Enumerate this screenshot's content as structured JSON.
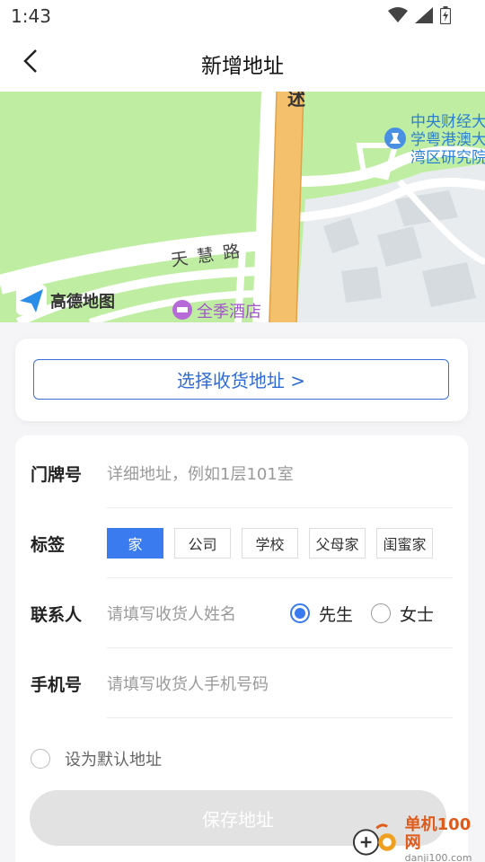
{
  "status": {
    "time": "1:43"
  },
  "nav": {
    "title": "新增地址"
  },
  "map": {
    "labels": {
      "road": "天 慧 路",
      "poi_university": [
        "中央财经大",
        "学粤港澳大",
        "湾区研究院"
      ],
      "poi_hotel": "全季酒店",
      "top_fragment": "述",
      "logo": "高德地图"
    }
  },
  "select_address": {
    "label": "选择收货地址 >"
  },
  "form": {
    "door": {
      "label": "门牌号",
      "placeholder": "详细地址，例如1层101室"
    },
    "tags": {
      "label": "标签",
      "items": [
        "家",
        "公司",
        "学校",
        "父母家",
        "闺蜜家"
      ],
      "selected": "家"
    },
    "contact": {
      "label": "联系人",
      "placeholder": "请填写收货人姓名",
      "gender_options": [
        "先生",
        "女士"
      ],
      "gender_selected": "先生"
    },
    "phone": {
      "label": "手机号",
      "placeholder": "请填写收货人手机号码"
    },
    "default_label": "设为默认地址",
    "save_label": "保存地址"
  },
  "watermark": {
    "name": "单机100网",
    "url": "danji100.com"
  },
  "colors": {
    "accent": "#3a7bf0",
    "map_green": "#bfeea3",
    "road_orange": "#f5c06b"
  }
}
